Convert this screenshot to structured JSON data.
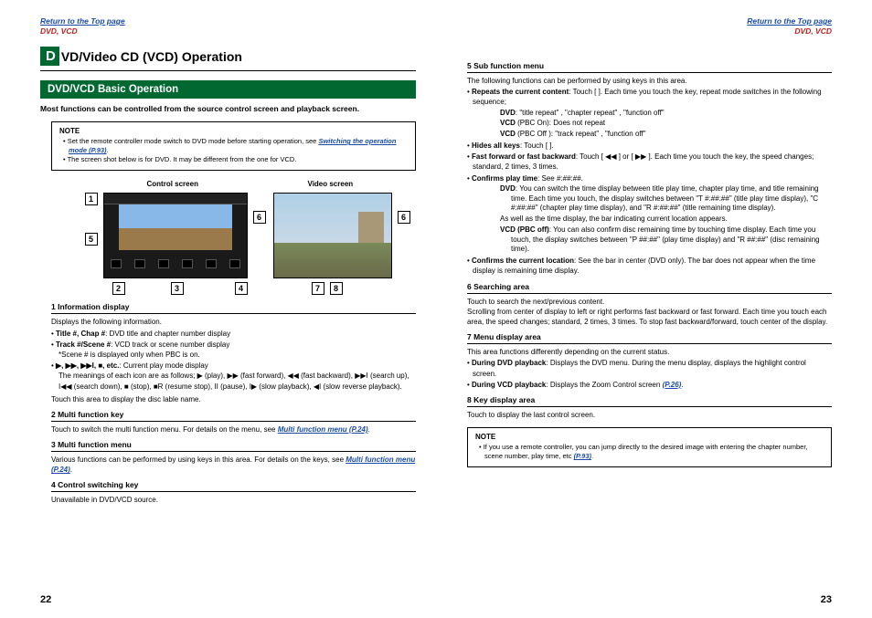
{
  "nav": {
    "return_link": "Return to the Top page",
    "breadcrumb": "DVD, VCD"
  },
  "title": {
    "dcap": "D",
    "rest": "VD/Video CD (VCD) Operation"
  },
  "section": {
    "title": "DVD/VCD Basic Operation",
    "intro": "Most functions can be controlled from the source control screen and playback screen."
  },
  "note1": {
    "title": "NOTE",
    "line1a": "Set the remote controller mode switch to DVD mode before starting operation, see ",
    "line1_link": "Switching the operation mode (P.93)",
    "line1b": ".",
    "line2": "The screen shot below is for DVD. It may be different from the one for VCD."
  },
  "figure": {
    "control_label": "Control screen",
    "video_label": "Video screen",
    "c1": "1",
    "c2": "2",
    "c3": "3",
    "c4": "4",
    "c5": "5",
    "c6": "6",
    "c7": "7",
    "c8": "8"
  },
  "items_left": {
    "i1": {
      "head": "1  Information display",
      "body1": "Displays the following information.",
      "b1_lab": "Title #, Chap #",
      "b1_txt": ": DVD title and chapter number display",
      "b2_lab": "Track #/Scene #",
      "b2_txt": ": VCD track or scene number display",
      "b2_note": "*Scene # is displayed only when PBC is on.",
      "b3_lab": "▶, ▶▶, ▶▶I, ■, etc.",
      "b3_txt": ": Current play mode display",
      "b3_line2": "The meanings of each icon are as follows; ▶ (play), ▶▶ (fast forward), ◀◀ (fast backward), ▶▶I (search up), I◀◀ (search down), ■ (stop), ■R (resume stop), II (pause), I▶ (slow playback), ◀I (slow reverse playback).",
      "body2": "Touch this area to display the disc lable name."
    },
    "i2": {
      "head": "2  Multi function key",
      "body1a": "Touch to switch the multi function menu. For details on the menu, see ",
      "body1_link": "Multi function menu (P.24)",
      "body1b": "."
    },
    "i3": {
      "head": "3  Multi function menu",
      "body1a": "Various functions can be performed by using keys in this area. For details on the keys, see ",
      "body1_link": "Multi function menu (P.24)",
      "body1b": "."
    },
    "i4": {
      "head": "4  Control switching key",
      "body1": "Unavailable in DVD/VCD source."
    }
  },
  "items_right": {
    "i5": {
      "head": "5  Sub function menu",
      "intro": "The following functions can be performed by using keys in this area.",
      "b1_lab": "Repeats the current content",
      "b1_txt": ": Touch [    ]. Each time you touch the key, repeat mode switches in the following sequence;",
      "b1_dvd_lab": "DVD",
      "b1_dvd_txt": ": \"title repeat\"      , \"chapter repeat\"      , \"function off\"",
      "b1_vcd1_lab": "VCD",
      "b1_vcd1_txt": " (PBC On): Does not repeat",
      "b1_vcd2_lab": "VCD",
      "b1_vcd2_txt": " (PBC Off ): \"track repeat\"      , \"function off\"",
      "b2_lab": "Hides all keys",
      "b2_txt": ": Touch [    ].",
      "b3_lab": "Fast forward or fast backward",
      "b3_txt": ": Touch [ ◀◀ ] or [ ▶▶ ]. Each time you touch the key, the speed changes; standard, 2 times, 3 times.",
      "b4_lab": "Confirms play time",
      "b4_txt": ": See #:##:##.",
      "b4_dvd_lab": "DVD",
      "b4_dvd_txt": ": You can switch the time display between title play time, chapter play time, and title remaining time. Each time you touch, the display switches between \"T #:##:##\" (title play time display), \"C #:##:##\" (chapter play time display), and \"R #:##:##\" (title remaining time display).",
      "b4_dvd_txt2": "As well as the time display, the bar indicating current location appears.",
      "b4_vcd_lab": "VCD (PBC off)",
      "b4_vcd_txt": ": You can also confirm disc remaining time by touching time display. Each time you touch, the display switches between \"P ##:##\" (play time display) and \"R ##:##\" (disc remaining time).",
      "b5_lab": "Confirms the current location",
      "b5_txt": ": See the bar in center (DVD only). The bar does not appear when the time display is remaining time display."
    },
    "i6": {
      "head": "6  Searching area",
      "body1": "Touch to search the next/previous content.",
      "body2": "Scrolling from center of display to left or right performs fast backward or fast forward. Each time you touch each area, the speed changes; standard, 2 times, 3 times. To stop fast backward/forward, touch center of the display."
    },
    "i7": {
      "head": "7  Menu display area",
      "body1": "This area functions differently depending on the current status.",
      "b1_lab": "During DVD playback",
      "b1_txt": ": Displays the DVD menu. During the menu display, displays the highlight control screen.",
      "b2_lab": "During VCD playback",
      "b2_txt": ": Displays the Zoom Control screen ",
      "b2_link": "(P.26)",
      "b2_after": "."
    },
    "i8": {
      "head": "8  Key display area",
      "body1": "Touch to display the last control screen."
    }
  },
  "note2": {
    "title": "NOTE",
    "line1a": "If you use a remote controller, you can jump directly to the desired image with entering the chapter number, scene number, play time, etc ",
    "line1_link": "(P.93)",
    "line1b": "."
  },
  "pagenum": {
    "left": "22",
    "right": "23"
  }
}
